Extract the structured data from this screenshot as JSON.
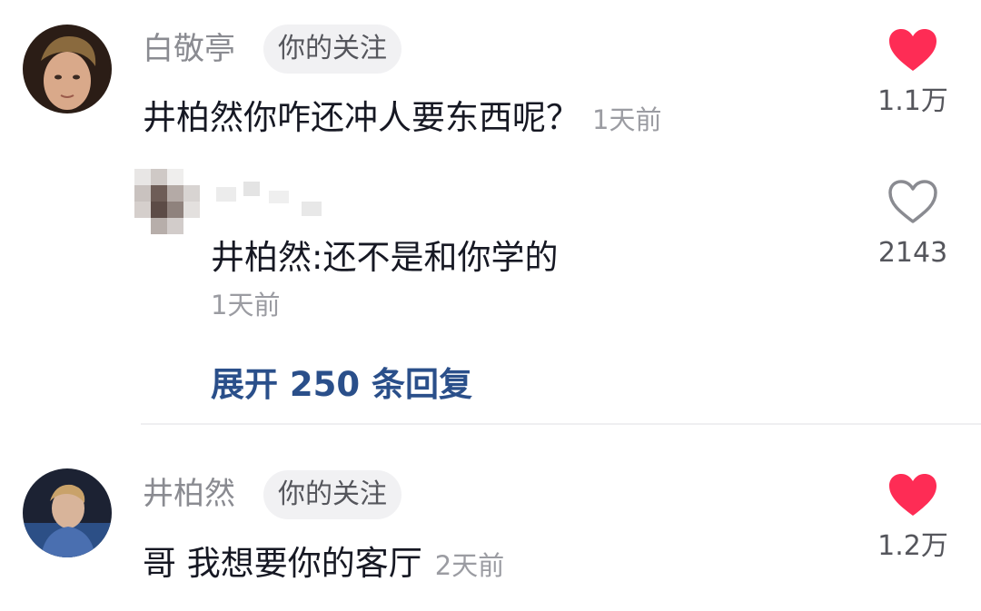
{
  "comments": [
    {
      "username": "白敬亭",
      "tag": "你的关注",
      "text": "井柏然你咋还冲人要东西呢？",
      "time": "1天前",
      "likes": "1.1万",
      "liked": true,
      "avatar_icon": "portrait-avatar",
      "reply": {
        "username_icon": "blurred-avatar",
        "text": "井柏然:还不是和你学的",
        "time": "1天前",
        "likes": "2143",
        "liked": false
      },
      "expand_label": "展开 250 条回复"
    },
    {
      "username": "井柏然",
      "tag": "你的关注",
      "text": "哥 我想要你的客厅",
      "time": "2天前",
      "likes": "1.2万",
      "liked": true,
      "avatar_icon": "portrait-avatar"
    }
  ],
  "colors": {
    "heart_red": "#fe2c55",
    "expand_blue": "#2a4f8a",
    "muted_text": "#8a8b91"
  }
}
